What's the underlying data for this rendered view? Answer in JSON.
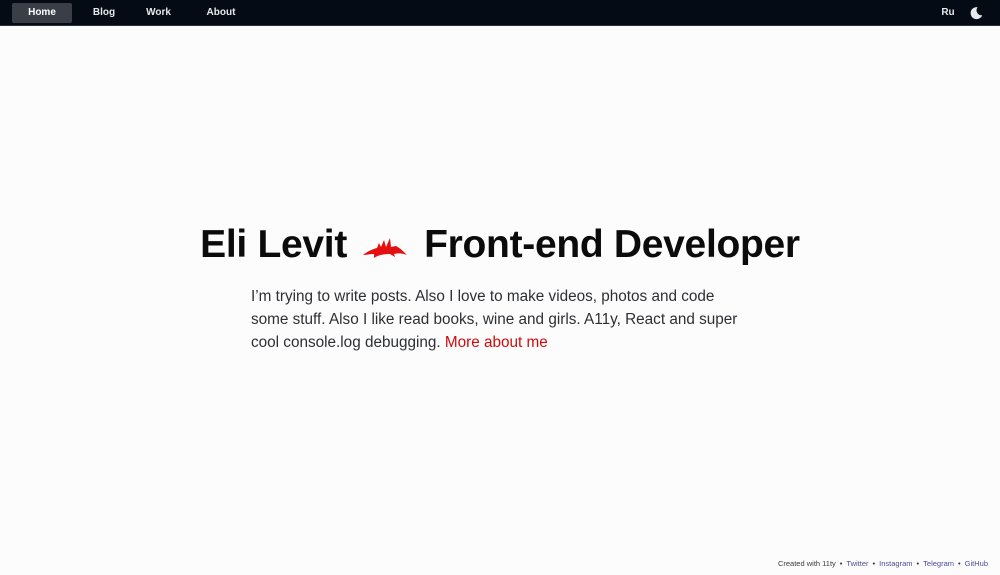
{
  "nav": {
    "items": [
      {
        "label": "Home",
        "active": true
      },
      {
        "label": "Blog",
        "active": false
      },
      {
        "label": "Work",
        "active": false
      },
      {
        "label": "About",
        "active": false
      }
    ],
    "language_label": "Ru",
    "theme_icon": "moon-icon"
  },
  "hero": {
    "name": "Eli Levit",
    "separator_icon": "red-wing-icon",
    "role": "Front-end Developer",
    "intro_text": "I’m trying to write posts. Also I love to make videos, photos and code some stuff. Also I like read books, wine and girls. A11y, React and super cool console.log debugging.",
    "more_link": "More about me"
  },
  "footer": {
    "created_prefix": "Created with ",
    "created_link": "11ty",
    "separator": "•",
    "links": [
      "Twitter",
      "Instagram",
      "Telegram",
      "GitHub"
    ]
  },
  "colors": {
    "topbar_bg": "#050b14",
    "nav_active_bg": "#3a3f47",
    "accent_red": "#d10b0b",
    "footer_link": "#4a4e9a"
  }
}
